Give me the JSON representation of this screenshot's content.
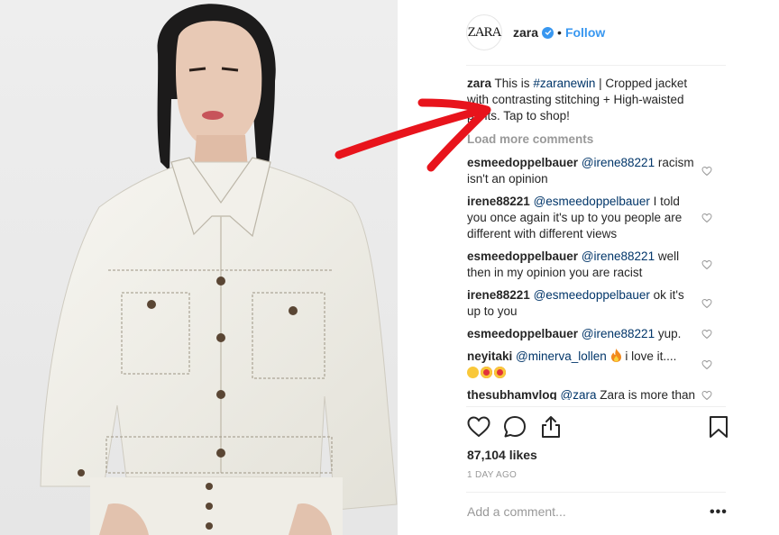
{
  "header": {
    "logo_text": "ZARA",
    "username": "zara",
    "separator": "•",
    "follow_label": "Follow"
  },
  "caption": {
    "username": "zara",
    "pre": "This is ",
    "hashtag": "#zaranewin",
    "post": " | Cropped jacket with contrasting stitching + High-waisted pants. Tap to shop!"
  },
  "load_more": "Load more comments",
  "comments": [
    {
      "user": "esmeedoppelbauer",
      "mention": "@irene88221",
      "text": " racism isn't an opinion"
    },
    {
      "user": "irene88221",
      "mention": "@esmeedoppelbauer",
      "text": " I told you once again it's up to you people are different with different views"
    },
    {
      "user": "esmeedoppelbauer",
      "mention": "@irene88221",
      "text": " well then in my opinion you are racist"
    },
    {
      "user": "irene88221",
      "mention": "@esmeedoppelbauer",
      "text": " ok it's up to you"
    },
    {
      "user": "esmeedoppelbauer",
      "mention": "@irene88221",
      "text": " yup."
    },
    {
      "user": "neyitaki",
      "mention": "@minerva_lollen",
      "text": " i love it...."
    },
    {
      "user": "thesubhamvlog",
      "mention": "@zara",
      "text": " Zara is more than love"
    }
  ],
  "likes": "87,104 likes",
  "time_ago": "1 DAY AGO",
  "add_comment_placeholder": "Add a comment...",
  "more_options": "•••",
  "colors": {
    "link_blue": "#3897f0",
    "mention_blue": "#003569",
    "muted_gray": "#999999",
    "arrow_red": "#e8141c"
  },
  "icons": [
    "verified-badge-icon",
    "heart-icon",
    "like-heart-icon",
    "comment-bubble-icon",
    "share-icon",
    "bookmark-icon",
    "fire-emoji-icon",
    "expressionless-emoji-icon",
    "heart-eyes-emoji-icon"
  ]
}
